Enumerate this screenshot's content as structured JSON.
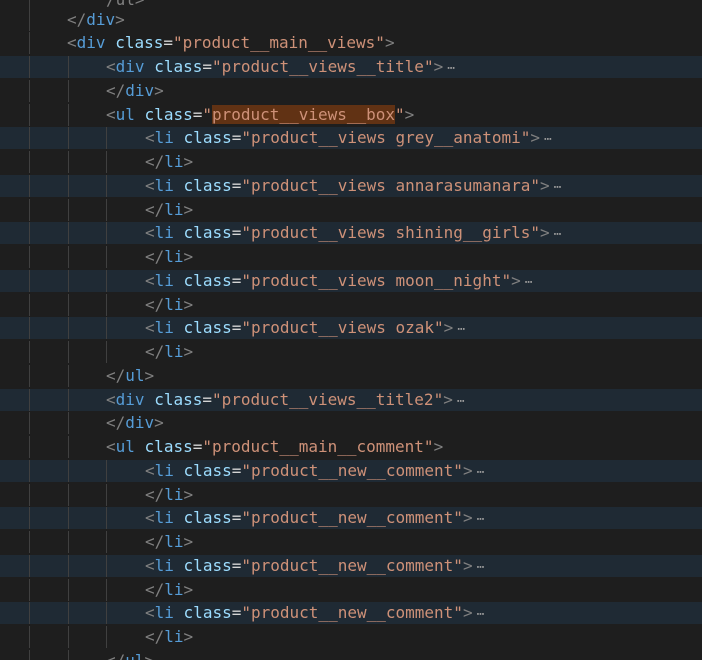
{
  "editor": {
    "lines": [
      {
        "top": "/ul>"
      },
      {
        "close": "div"
      },
      {
        "tag": "div",
        "cls": "product__main__views"
      },
      {
        "tag": "div",
        "cls": "product__views__title",
        "folded": true
      },
      {
        "close": "div"
      },
      {
        "tag": "ul",
        "cls_pre": "",
        "cls_hl": "product__views__box",
        "cls_post": ""
      },
      {
        "tag": "li",
        "cls": "product__views grey__anatomi",
        "folded": true
      },
      {
        "close": "li"
      },
      {
        "tag": "li",
        "cls": "product__views annarasumanara",
        "folded": true
      },
      {
        "close": "li"
      },
      {
        "tag": "li",
        "cls": "product__views shining__girls",
        "folded": true
      },
      {
        "close": "li"
      },
      {
        "tag": "li",
        "cls": "product__views moon__night",
        "folded": true
      },
      {
        "close": "li"
      },
      {
        "tag": "li",
        "cls": "product__views ozak",
        "folded": true
      },
      {
        "close": "li"
      },
      {
        "close": "ul"
      },
      {
        "tag": "div",
        "cls": "product__views__title2",
        "folded": true
      },
      {
        "close": "div"
      },
      {
        "tag": "ul",
        "cls": "product__main__comment"
      },
      {
        "tag": "li",
        "cls": "product__new__comment",
        "folded": true
      },
      {
        "close": "li"
      },
      {
        "tag": "li",
        "cls": "product__new__comment",
        "folded": true
      },
      {
        "close": "li"
      },
      {
        "tag": "li",
        "cls": "product__new__comment",
        "folded": true
      },
      {
        "close": "li"
      },
      {
        "tag": "li",
        "cls": "product__new__comment",
        "folded": true
      },
      {
        "close": "li"
      },
      {
        "close": "ul"
      }
    ],
    "text": {
      "attr_name": "class",
      "equals": "=",
      "quote": "\"",
      "lt": "<",
      "gt": ">",
      "lt_slash": "</",
      "fold_marker": "⋯"
    }
  }
}
